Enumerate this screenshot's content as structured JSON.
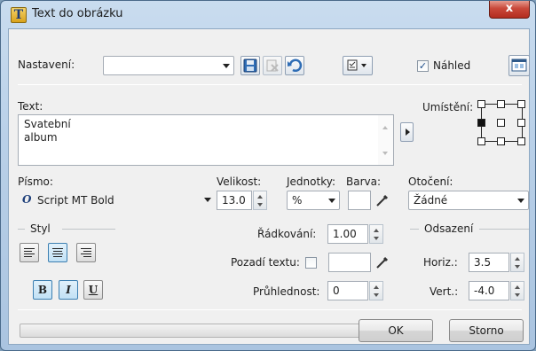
{
  "window": {
    "title": "Text do obrázku",
    "icon": "T",
    "close_label": "x"
  },
  "preset": {
    "label": "Nastavení:",
    "value": ""
  },
  "toolbar": {
    "save_icon": "save-icon",
    "delete_icon": "delete-icon",
    "undo_icon": "undo-icon",
    "options_icon": "options-menu-icon"
  },
  "preview": {
    "label": "Náhled",
    "checked": true
  },
  "text": {
    "label": "Text:",
    "line1": "Svatební",
    "line2": "album"
  },
  "placement": {
    "label": "Umístění:",
    "selected": "middle-left"
  },
  "font": {
    "label": "Písmo:",
    "value": "Script MT Bold",
    "icon": "O"
  },
  "size": {
    "label": "Velikost:",
    "value": "13.0"
  },
  "units": {
    "label": "Jednotky:",
    "value": "%"
  },
  "color": {
    "label": "Barva:"
  },
  "rotation": {
    "label": "Otočení:",
    "value": "Žádné"
  },
  "style": {
    "group_label": "Styl",
    "bold": "B",
    "italic": "I",
    "underline": "U"
  },
  "line_spacing": {
    "label": "Řádkování:",
    "value": "1.00"
  },
  "background": {
    "label": "Pozadí textu:",
    "checked": false
  },
  "opacity": {
    "label": "Průhlednost:",
    "value": "0"
  },
  "offset": {
    "group_label": "Odsazení",
    "horiz_label": "Horiz.:",
    "horiz_value": "3.5",
    "vert_label": "Vert.:",
    "vert_value": "-4.0"
  },
  "buttons": {
    "ok": "OK",
    "cancel": "Storno"
  },
  "colors": {
    "titlebar": "#b9d0e8",
    "close": "#c9483a",
    "accent": "#3c7fb1"
  }
}
